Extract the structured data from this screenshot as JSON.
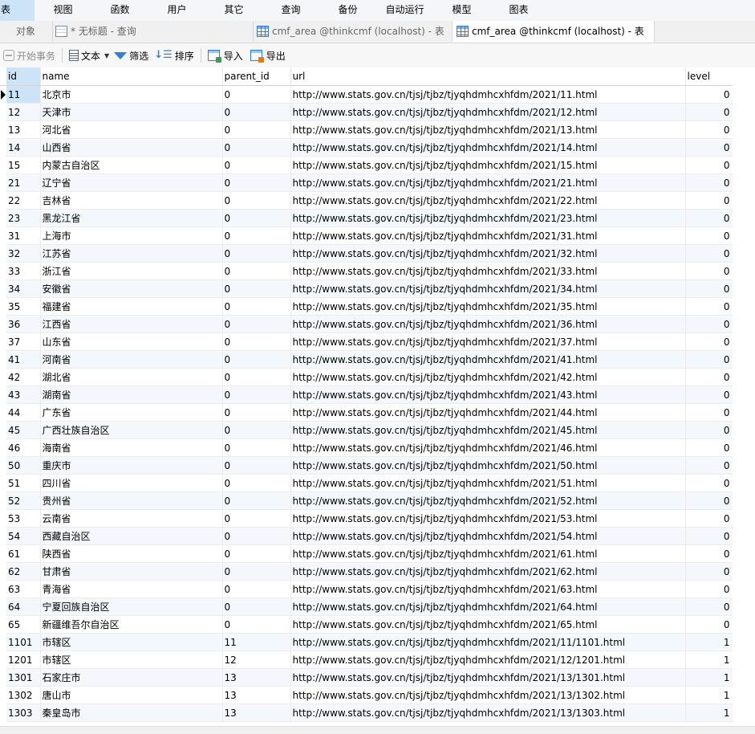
{
  "menu": [
    "表",
    "视图",
    "函数",
    "用户",
    "其它",
    "查询",
    "备份",
    "自动运行",
    "模型",
    "图表"
  ],
  "tabs": {
    "objects": "对象",
    "query": "* 无标题 - 查询",
    "table1": "cmf_area @thinkcmf (localhost) - 表",
    "table2": "cmf_area @thinkcmf (localhost) - 表"
  },
  "toolbar": {
    "begin_transaction": "开始事务",
    "text": "文本",
    "filter": "筛选",
    "sort": "排序",
    "import": "导入",
    "export": "导出"
  },
  "icons": {
    "transaction": "transaction-icon",
    "text": "text-icon",
    "filter": "filter-icon",
    "sort": "sort-icon",
    "import": "import-icon",
    "export": "export-icon",
    "table": "table-icon",
    "query": "query-icon"
  },
  "colors": {
    "selection": "#cde3f8",
    "accent": "#2f7fd8",
    "row_alt": "#f4f8fd"
  },
  "grid": {
    "columns": [
      "id",
      "name",
      "parent_id",
      "url",
      "level"
    ],
    "rows": [
      [
        "11",
        "北京市",
        "0",
        "http://www.stats.gov.cn/tjsj/tjbz/tjyqhdmhcxhfdm/2021/11.html",
        "0"
      ],
      [
        "12",
        "天津市",
        "0",
        "http://www.stats.gov.cn/tjsj/tjbz/tjyqhdmhcxhfdm/2021/12.html",
        "0"
      ],
      [
        "13",
        "河北省",
        "0",
        "http://www.stats.gov.cn/tjsj/tjbz/tjyqhdmhcxhfdm/2021/13.html",
        "0"
      ],
      [
        "14",
        "山西省",
        "0",
        "http://www.stats.gov.cn/tjsj/tjbz/tjyqhdmhcxhfdm/2021/14.html",
        "0"
      ],
      [
        "15",
        "内蒙古自治区",
        "0",
        "http://www.stats.gov.cn/tjsj/tjbz/tjyqhdmhcxhfdm/2021/15.html",
        "0"
      ],
      [
        "21",
        "辽宁省",
        "0",
        "http://www.stats.gov.cn/tjsj/tjbz/tjyqhdmhcxhfdm/2021/21.html",
        "0"
      ],
      [
        "22",
        "吉林省",
        "0",
        "http://www.stats.gov.cn/tjsj/tjbz/tjyqhdmhcxhfdm/2021/22.html",
        "0"
      ],
      [
        "23",
        "黑龙江省",
        "0",
        "http://www.stats.gov.cn/tjsj/tjbz/tjyqhdmhcxhfdm/2021/23.html",
        "0"
      ],
      [
        "31",
        "上海市",
        "0",
        "http://www.stats.gov.cn/tjsj/tjbz/tjyqhdmhcxhfdm/2021/31.html",
        "0"
      ],
      [
        "32",
        "江苏省",
        "0",
        "http://www.stats.gov.cn/tjsj/tjbz/tjyqhdmhcxhfdm/2021/32.html",
        "0"
      ],
      [
        "33",
        "浙江省",
        "0",
        "http://www.stats.gov.cn/tjsj/tjbz/tjyqhdmhcxhfdm/2021/33.html",
        "0"
      ],
      [
        "34",
        "安徽省",
        "0",
        "http://www.stats.gov.cn/tjsj/tjbz/tjyqhdmhcxhfdm/2021/34.html",
        "0"
      ],
      [
        "35",
        "福建省",
        "0",
        "http://www.stats.gov.cn/tjsj/tjbz/tjyqhdmhcxhfdm/2021/35.html",
        "0"
      ],
      [
        "36",
        "江西省",
        "0",
        "http://www.stats.gov.cn/tjsj/tjbz/tjyqhdmhcxhfdm/2021/36.html",
        "0"
      ],
      [
        "37",
        "山东省",
        "0",
        "http://www.stats.gov.cn/tjsj/tjbz/tjyqhdmhcxhfdm/2021/37.html",
        "0"
      ],
      [
        "41",
        "河南省",
        "0",
        "http://www.stats.gov.cn/tjsj/tjbz/tjyqhdmhcxhfdm/2021/41.html",
        "0"
      ],
      [
        "42",
        "湖北省",
        "0",
        "http://www.stats.gov.cn/tjsj/tjbz/tjyqhdmhcxhfdm/2021/42.html",
        "0"
      ],
      [
        "43",
        "湖南省",
        "0",
        "http://www.stats.gov.cn/tjsj/tjbz/tjyqhdmhcxhfdm/2021/43.html",
        "0"
      ],
      [
        "44",
        "广东省",
        "0",
        "http://www.stats.gov.cn/tjsj/tjbz/tjyqhdmhcxhfdm/2021/44.html",
        "0"
      ],
      [
        "45",
        "广西壮族自治区",
        "0",
        "http://www.stats.gov.cn/tjsj/tjbz/tjyqhdmhcxhfdm/2021/45.html",
        "0"
      ],
      [
        "46",
        "海南省",
        "0",
        "http://www.stats.gov.cn/tjsj/tjbz/tjyqhdmhcxhfdm/2021/46.html",
        "0"
      ],
      [
        "50",
        "重庆市",
        "0",
        "http://www.stats.gov.cn/tjsj/tjbz/tjyqhdmhcxhfdm/2021/50.html",
        "0"
      ],
      [
        "51",
        "四川省",
        "0",
        "http://www.stats.gov.cn/tjsj/tjbz/tjyqhdmhcxhfdm/2021/51.html",
        "0"
      ],
      [
        "52",
        "贵州省",
        "0",
        "http://www.stats.gov.cn/tjsj/tjbz/tjyqhdmhcxhfdm/2021/52.html",
        "0"
      ],
      [
        "53",
        "云南省",
        "0",
        "http://www.stats.gov.cn/tjsj/tjbz/tjyqhdmhcxhfdm/2021/53.html",
        "0"
      ],
      [
        "54",
        "西藏自治区",
        "0",
        "http://www.stats.gov.cn/tjsj/tjbz/tjyqhdmhcxhfdm/2021/54.html",
        "0"
      ],
      [
        "61",
        "陕西省",
        "0",
        "http://www.stats.gov.cn/tjsj/tjbz/tjyqhdmhcxhfdm/2021/61.html",
        "0"
      ],
      [
        "62",
        "甘肃省",
        "0",
        "http://www.stats.gov.cn/tjsj/tjbz/tjyqhdmhcxhfdm/2021/62.html",
        "0"
      ],
      [
        "63",
        "青海省",
        "0",
        "http://www.stats.gov.cn/tjsj/tjbz/tjyqhdmhcxhfdm/2021/63.html",
        "0"
      ],
      [
        "64",
        "宁夏回族自治区",
        "0",
        "http://www.stats.gov.cn/tjsj/tjbz/tjyqhdmhcxhfdm/2021/64.html",
        "0"
      ],
      [
        "65",
        "新疆维吾尔自治区",
        "0",
        "http://www.stats.gov.cn/tjsj/tjbz/tjyqhdmhcxhfdm/2021/65.html",
        "0"
      ],
      [
        "1101",
        "市辖区",
        "11",
        "http://www.stats.gov.cn/tjsj/tjbz/tjyqhdmhcxhfdm/2021/11/1101.html",
        "1"
      ],
      [
        "1201",
        "市辖区",
        "12",
        "http://www.stats.gov.cn/tjsj/tjbz/tjyqhdmhcxhfdm/2021/12/1201.html",
        "1"
      ],
      [
        "1301",
        "石家庄市",
        "13",
        "http://www.stats.gov.cn/tjsj/tjbz/tjyqhdmhcxhfdm/2021/13/1301.html",
        "1"
      ],
      [
        "1302",
        "唐山市",
        "13",
        "http://www.stats.gov.cn/tjsj/tjbz/tjyqhdmhcxhfdm/2021/13/1302.html",
        "1"
      ],
      [
        "1303",
        "秦皇岛市",
        "13",
        "http://www.stats.gov.cn/tjsj/tjbz/tjyqhdmhcxhfdm/2021/13/1303.html",
        "1"
      ]
    ]
  }
}
